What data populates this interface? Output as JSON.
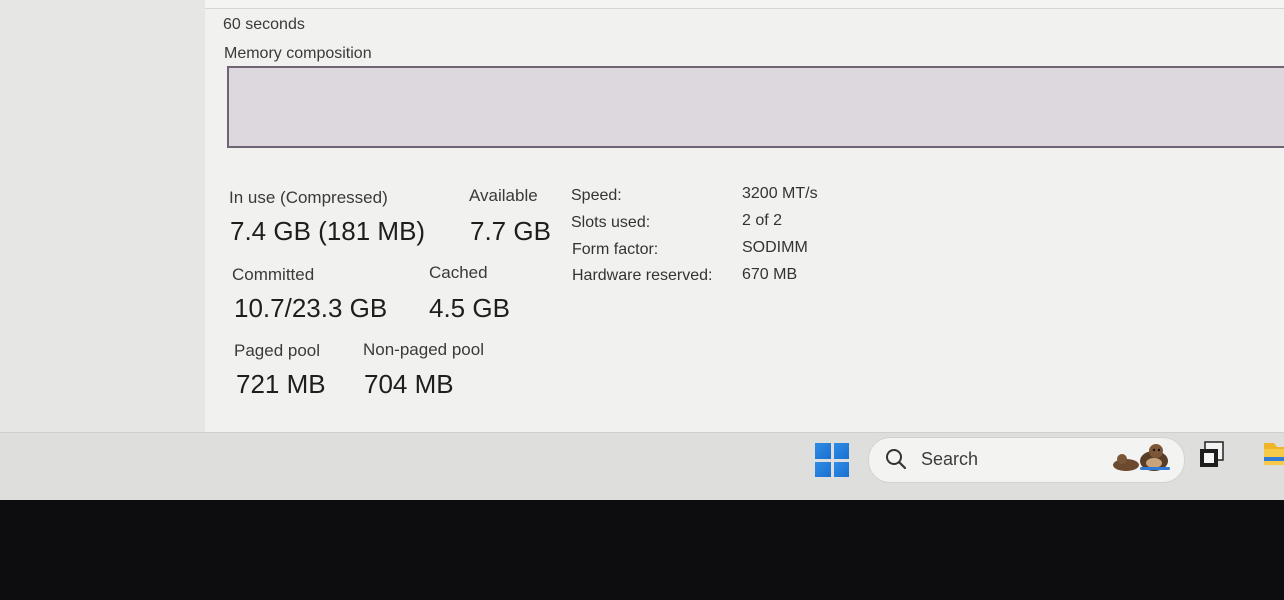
{
  "graph": {
    "time_label": "60 seconds",
    "memory_composition_label": "Memory composition"
  },
  "stats": {
    "in_use_label": "In use (Compressed)",
    "in_use_value": "7.4 GB (181 MB)",
    "available_label": "Available",
    "available_value": "7.7 GB",
    "committed_label": "Committed",
    "committed_value": "10.7/23.3 GB",
    "cached_label": "Cached",
    "cached_value": "4.5 GB",
    "paged_pool_label": "Paged pool",
    "paged_pool_value": "721 MB",
    "non_paged_pool_label": "Non-paged pool",
    "non_paged_pool_value": "704 MB"
  },
  "specs": [
    {
      "label": "Speed:",
      "value": "3200 MT/s"
    },
    {
      "label": "Slots used:",
      "value": "2 of 2"
    },
    {
      "label": "Form factor:",
      "value": "SODIMM"
    },
    {
      "label": "Hardware reserved:",
      "value": "670 MB"
    }
  ],
  "taskbar": {
    "search_label": "Search",
    "icons": [
      "windows-start-icon",
      "search-icon",
      "otter-widget-icon",
      "task-view-icon",
      "file-explorer-icon"
    ]
  },
  "colors": {
    "composition_bar_fill": "#ddd7de",
    "composition_bar_border": "#6f6374",
    "windows_blue": "#1a6fd1"
  }
}
